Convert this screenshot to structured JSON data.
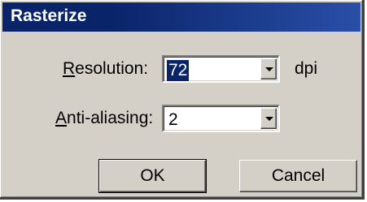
{
  "dialog": {
    "title": "Rasterize",
    "resolution": {
      "label_accel": "R",
      "label_rest": "esolution:",
      "value": "72",
      "unit": "dpi"
    },
    "antialiasing": {
      "label_accel": "A",
      "label_rest": "nti-aliasing:",
      "value": "2"
    },
    "buttons": {
      "ok": "OK",
      "cancel": "Cancel"
    }
  },
  "colors": {
    "title_bar": "#0a246a",
    "face": "#d4d0c8",
    "selection": "#0a246a"
  }
}
